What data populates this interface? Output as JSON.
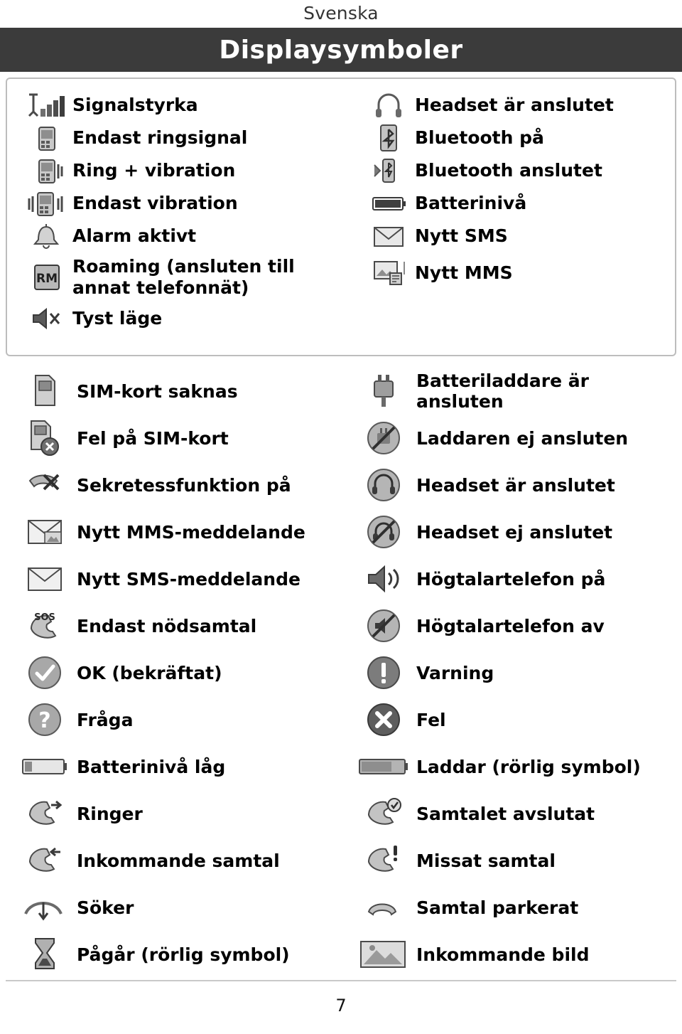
{
  "header": {
    "language": "Svenska",
    "title": "Displaysymboler"
  },
  "top_panel": {
    "left_column": [
      {
        "icon": "signal-strength-icon",
        "label": "Signalstyrka"
      },
      {
        "icon": "ring-only-icon",
        "label": "Endast ringsignal"
      },
      {
        "icon": "ring-and-vibrate-icon",
        "label": "Ring + vibration"
      },
      {
        "icon": "vibrate-only-icon",
        "label": "Endast vibration"
      },
      {
        "icon": "alarm-bell-icon",
        "label": "Alarm aktivt"
      },
      {
        "icon": "roaming-icon",
        "label": "Roaming (ansluten till annat telefonnät)"
      },
      {
        "icon": "silent-mode-icon",
        "label": "Tyst läge"
      }
    ],
    "right_column": [
      {
        "icon": "headset-connected-icon",
        "label": "Headset är anslutet"
      },
      {
        "icon": "bluetooth-on-icon",
        "label": "Bluetooth på"
      },
      {
        "icon": "bluetooth-connected-icon",
        "label": "Bluetooth anslutet"
      },
      {
        "icon": "battery-level-icon",
        "label": "Batterinivå"
      },
      {
        "icon": "new-sms-icon",
        "label": "Nytt SMS"
      },
      {
        "icon": "new-mms-icon",
        "label": "Nytt MMS"
      }
    ]
  },
  "bottom_table": {
    "left_column": [
      {
        "icon": "sim-card-missing-icon",
        "label": "SIM-kort saknas"
      },
      {
        "icon": "sim-card-error-icon",
        "label": "Fel på SIM-kort"
      },
      {
        "icon": "privacy-function-icon",
        "label": "Sekretessfunktion på"
      },
      {
        "icon": "new-mms-message-icon",
        "label": "Nytt MMS-meddelande"
      },
      {
        "icon": "new-sms-message-icon",
        "label": "Nytt SMS-meddelande"
      },
      {
        "icon": "emergency-calls-only-icon",
        "label": "Endast nödsamtal"
      },
      {
        "icon": "ok-check-icon",
        "label": "OK (bekräftat)"
      },
      {
        "icon": "question-icon",
        "label": "Fråga"
      },
      {
        "icon": "battery-low-icon",
        "label": "Batterinivå låg"
      },
      {
        "icon": "outgoing-call-icon",
        "label": "Ringer"
      },
      {
        "icon": "incoming-call-icon",
        "label": "Inkommande samtal"
      },
      {
        "icon": "searching-icon",
        "label": "Söker"
      },
      {
        "icon": "hourglass-icon",
        "label": "Pågår (rörlig symbol)"
      }
    ],
    "right_column": [
      {
        "icon": "charger-connected-icon",
        "label": "Batteriladdare är ansluten"
      },
      {
        "icon": "charger-not-connected-icon",
        "label": "Laddaren ej ansluten"
      },
      {
        "icon": "headset-connected-icon",
        "label": "Headset är anslutet"
      },
      {
        "icon": "headset-disconnected-icon",
        "label": "Headset ej anslutet"
      },
      {
        "icon": "speakerphone-on-icon",
        "label": "Högtalartelefon på"
      },
      {
        "icon": "speakerphone-off-icon",
        "label": "Högtalartelefon av"
      },
      {
        "icon": "warning-icon",
        "label": "Varning"
      },
      {
        "icon": "error-icon",
        "label": "Fel"
      },
      {
        "icon": "charging-icon",
        "label": "Laddar (rörlig symbol)"
      },
      {
        "icon": "call-ended-icon",
        "label": "Samtalet avslutat"
      },
      {
        "icon": "missed-call-icon",
        "label": "Missat samtal"
      },
      {
        "icon": "call-on-hold-icon",
        "label": "Samtal parkerat"
      },
      {
        "icon": "incoming-picture-icon",
        "label": "Inkommande bild"
      }
    ]
  },
  "footer": {
    "page_number": "7"
  }
}
